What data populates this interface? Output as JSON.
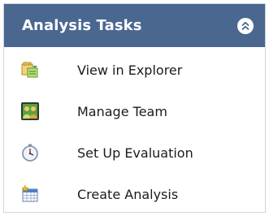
{
  "panel": {
    "title": "Analysis Tasks",
    "collapse_icon": "double-chevron-up-icon",
    "colors": {
      "header_bg": "#4a6790",
      "header_text": "#ffffff",
      "border": "#cfd5dc"
    }
  },
  "tasks": [
    {
      "label": "View in Explorer",
      "icon": "explorer-icon"
    },
    {
      "label": "Manage Team",
      "icon": "team-icon"
    },
    {
      "label": "Set Up Evaluation",
      "icon": "stopwatch-icon"
    },
    {
      "label": "Create Analysis",
      "icon": "calendar-icon"
    }
  ]
}
